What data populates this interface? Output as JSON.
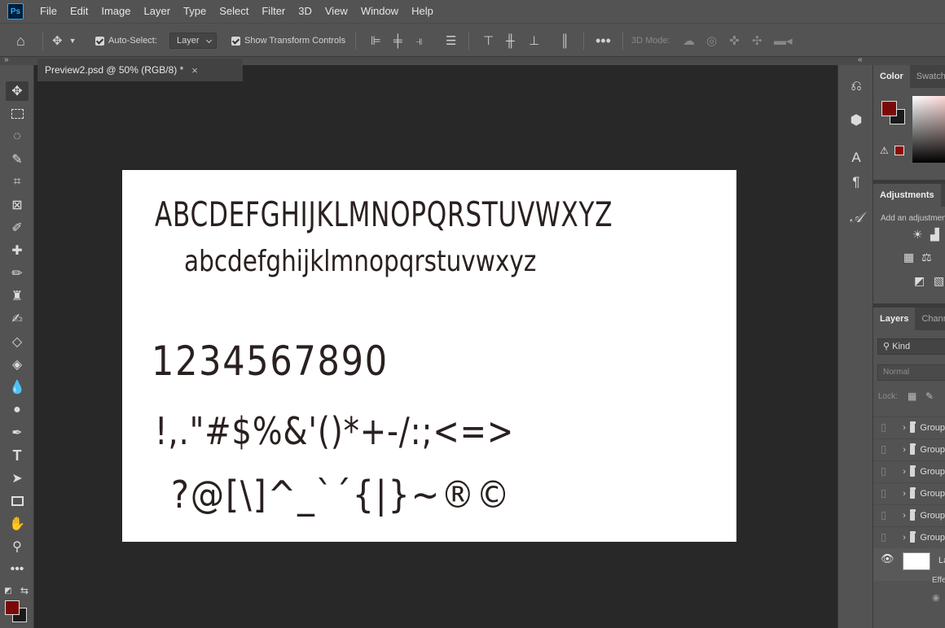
{
  "app": {
    "logo_text": "Ps"
  },
  "menu": [
    "File",
    "Edit",
    "Image",
    "Layer",
    "Type",
    "Select",
    "Filter",
    "3D",
    "View",
    "Window",
    "Help"
  ],
  "options_bar": {
    "auto_select_label": "Auto-Select:",
    "auto_select_value": "Layer",
    "show_transform_label": "Show Transform Controls",
    "three_d_mode_label": "3D Mode:"
  },
  "document": {
    "tab_title": "Preview2.psd @ 50% (RGB/8) *",
    "close_glyph": "×",
    "font_preview": {
      "uppercase": "ABCDEFGHIJKLMNOPQRSTUVWXYZ",
      "lowercase": "abcdefghijklmnopqrstuvwxyz",
      "digits": "1234567890",
      "punctuation_1": "!,.\"#$%&'()*+-/:;<=>",
      "punctuation_2": "?@[\\]^_`´{|}~®©"
    }
  },
  "tools": [
    "move",
    "marquee",
    "lasso",
    "quick-select",
    "crop",
    "frame",
    "eyedropper",
    "healing",
    "brush",
    "stamp",
    "history-brush",
    "eraser",
    "paint-bucket",
    "blur",
    "dodge",
    "pen",
    "type",
    "path-select",
    "rectangle",
    "hand",
    "zoom",
    "more"
  ],
  "colors": {
    "foreground": "#7a0a0a",
    "background": "#1a1a1a",
    "accent": "#31a8ff"
  },
  "panels": {
    "color_tabs": [
      "Color",
      "Swatches"
    ],
    "adjustments_tab": "Adjustments",
    "adjustments_hint": "Add an adjustment",
    "layers_tabs": [
      "Layers",
      "Channels"
    ],
    "kind_filter": "Kind",
    "blend_mode": "Normal",
    "lock_label": "Lock:",
    "layers": [
      {
        "type": "group",
        "name": "Group"
      },
      {
        "type": "group",
        "name": "Group"
      },
      {
        "type": "group",
        "name": "Group"
      },
      {
        "type": "group",
        "name": "Group"
      },
      {
        "type": "group",
        "name": "Group"
      },
      {
        "type": "group",
        "name": "Group"
      }
    ],
    "text_layer": {
      "name": "Layer",
      "effects_label": "Effects"
    }
  }
}
